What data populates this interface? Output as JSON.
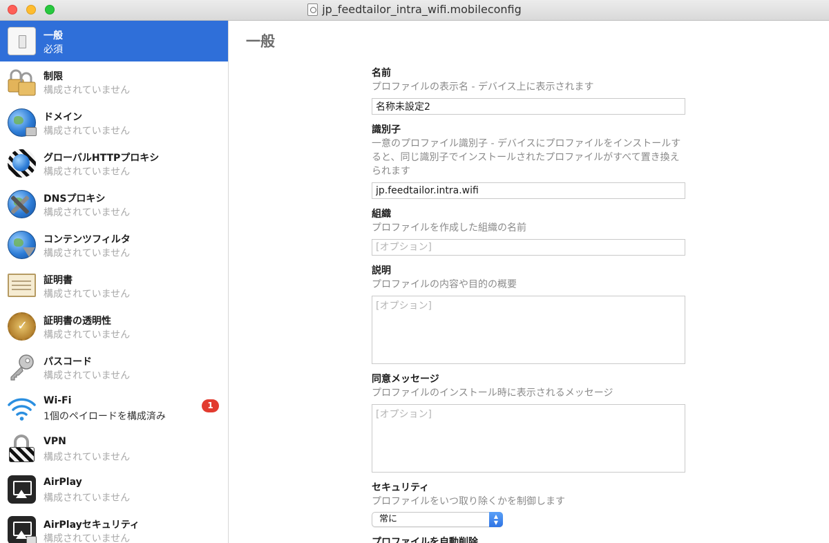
{
  "window": {
    "title": "jp_feedtailor_intra_wifi.mobileconfig"
  },
  "sidebar": {
    "items": [
      {
        "title": "一般",
        "subtitle": "必須",
        "icon": "switch-icon"
      },
      {
        "title": "制限",
        "subtitle": "構成されていません",
        "icon": "padlocks-icon"
      },
      {
        "title": "ドメイン",
        "subtitle": "構成されていません",
        "icon": "globe-lock-icon"
      },
      {
        "title": "グローバルHTTPプロキシ",
        "subtitle": "構成されていません",
        "icon": "globe-proxy-icon"
      },
      {
        "title": "DNSプロキシ",
        "subtitle": "構成されていません",
        "icon": "globe-tools-icon"
      },
      {
        "title": "コンテンツフィルタ",
        "subtitle": "構成されていません",
        "icon": "globe-filter-icon"
      },
      {
        "title": "証明書",
        "subtitle": "構成されていません",
        "icon": "certificate-icon"
      },
      {
        "title": "証明書の透明性",
        "subtitle": "構成されていません",
        "icon": "seal-icon"
      },
      {
        "title": "パスコード",
        "subtitle": "構成されていません",
        "icon": "key-icon"
      },
      {
        "title": "Wi-Fi",
        "subtitle": "1個のペイロードを構成済み",
        "icon": "wifi-icon",
        "badge": "1"
      },
      {
        "title": "VPN",
        "subtitle": "構成されていません",
        "icon": "vpn-lock-icon"
      },
      {
        "title": "AirPlay",
        "subtitle": "構成されていません",
        "icon": "airplay-icon"
      },
      {
        "title": "AirPlayセキュリティ",
        "subtitle": "構成されていません",
        "icon": "airplay-security-icon"
      }
    ]
  },
  "main": {
    "title": "一般",
    "fields": {
      "name": {
        "label": "名前",
        "desc": "プロファイルの表示名 - デバイス上に表示されます",
        "value": "名称未設定2"
      },
      "identifier": {
        "label": "識別子",
        "desc": "一意のプロファイル識別子 - デバイスにプロファイルをインストールすると、同じ識別子でインストールされたプロファイルがすべて置き換えられます",
        "value": "jp.feedtailor.intra.wifi"
      },
      "organization": {
        "label": "組織",
        "desc": "プロファイルを作成した組織の名前",
        "placeholder": "[オプション]"
      },
      "description": {
        "label": "説明",
        "desc": "プロファイルの内容や目的の概要",
        "placeholder": "[オプション]"
      },
      "consent": {
        "label": "同意メッセージ",
        "desc": "プロファイルのインストール時に表示されるメッセージ",
        "placeholder": "[オプション]"
      },
      "security": {
        "label": "セキュリティ",
        "desc": "プロファイルをいつ取り除くかを制御します",
        "selected": "常に"
      },
      "auto_remove": {
        "label": "プロファイルを自動削除"
      }
    }
  },
  "colors": {
    "selection": "#2f6fd9",
    "badge": "#e23b2f",
    "select_accent": "#2f74e4"
  }
}
